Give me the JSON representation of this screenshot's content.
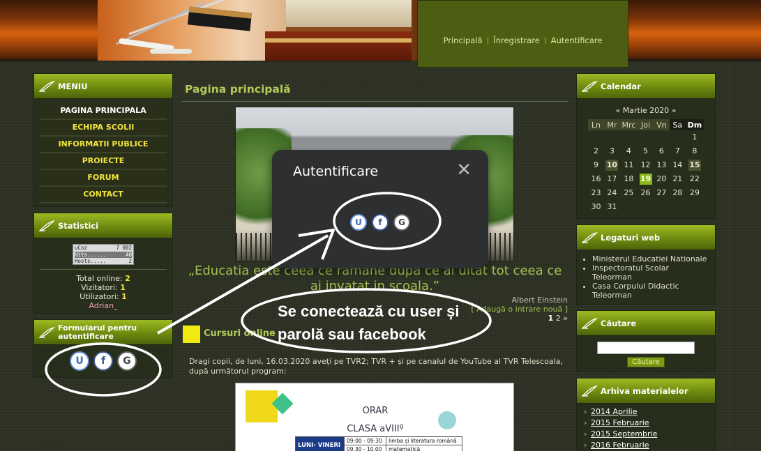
{
  "header": {
    "nav": [
      "Principală",
      "Înregistrare",
      "Autentificare"
    ]
  },
  "menu": {
    "title": "MENIU",
    "items": [
      "PAGINA PRINCIPALA",
      "ECHIPA SCOLII",
      "INFORMATII PUBLICE",
      "PROIECTE",
      "FORUM",
      "CONTACT"
    ]
  },
  "stats": {
    "title": "Statistici",
    "counter_brand": "uCoz",
    "counter_total": "7 002",
    "hits_label": "Hits......",
    "hits_value": "40",
    "hosts_label": "Hosts.....",
    "hosts_value": "2",
    "total_online_label": "Total online:",
    "total_online_value": "2",
    "visitors_label": "Vizitatori:",
    "visitors_value": "1",
    "users_label": "Utilizatori:",
    "users_value": "1",
    "user_name": "Adrian_"
  },
  "auth_block": {
    "title": "Formularul pentru autentificare",
    "buttons": [
      "U",
      "f",
      "G"
    ]
  },
  "main": {
    "page_title": "Pagina principală",
    "quote": "„Educatia este ceea ce ramane dupa ce ai uitat tot ceea ce ai invatat in scoala.”",
    "quote_author": "Albert Einstein",
    "add_entry": "[ Adaugă o intrare nouă ]",
    "pager_current": "1",
    "pager_next": "2",
    "pager_arrow": "»",
    "post_title": "Cursuri online",
    "post_text": "Dragi copii, de luni, 16.03.2020 aveți pe TVR2; TVR + și pe canalul de YouTube al TVR Telescoala, după următorul program:",
    "orar_title": "ORAR",
    "orar_sub": "CLASA aVIIIº",
    "orar_day": "LUNI- VINERI",
    "orar_rows": [
      {
        "time": "09:00 - 09:30",
        "subject": "limba și literatura română"
      },
      {
        "time": "09.30 - 10.00",
        "subject": "matematică"
      }
    ]
  },
  "calendar": {
    "title": "Calendar",
    "prev": "«",
    "month": "Martie 2020",
    "next": "»",
    "days": [
      "Ln",
      "Mr",
      "Mrc",
      "Joi",
      "Vn",
      "Sa",
      "Dm"
    ],
    "weeks": [
      [
        "",
        "",
        "",
        "",
        "",
        "",
        "1"
      ],
      [
        "2",
        "3",
        "4",
        "5",
        "6",
        "7",
        "8"
      ],
      [
        "9",
        "10",
        "11",
        "12",
        "13",
        "14",
        "15"
      ],
      [
        "16",
        "17",
        "18",
        "19",
        "20",
        "21",
        "22"
      ],
      [
        "23",
        "24",
        "25",
        "26",
        "27",
        "28",
        "29"
      ],
      [
        "30",
        "31",
        "",
        "",
        "",
        "",
        ""
      ]
    ],
    "highlighted": [
      "10",
      "15"
    ],
    "today": "19"
  },
  "links": {
    "title": "Legaturi web",
    "items": [
      "Ministerul Educatiei Nationale",
      "Inspectoratul Scolar Teleorman",
      "Casa Corpului Didactic Teleorman"
    ]
  },
  "search": {
    "title": "Căutare",
    "button": "Căutare"
  },
  "archive": {
    "title": "Arhiva materialelor",
    "items": [
      "2014 Aprilie",
      "2015 Februarie",
      "2015 Septembrie",
      "2016 Februarie"
    ]
  },
  "modal": {
    "title": "Autentificare",
    "close": "✕",
    "buttons": [
      "U",
      "f",
      "G"
    ]
  },
  "annotation": {
    "line1": "Se conectează cu user și",
    "line2": "parolă sau facebook"
  },
  "colors": {
    "accent_green": "#8ab81a",
    "menu_yellow": "#f0e63c",
    "header_orange": "#d8630e",
    "nav_box": "#4d5e12"
  }
}
